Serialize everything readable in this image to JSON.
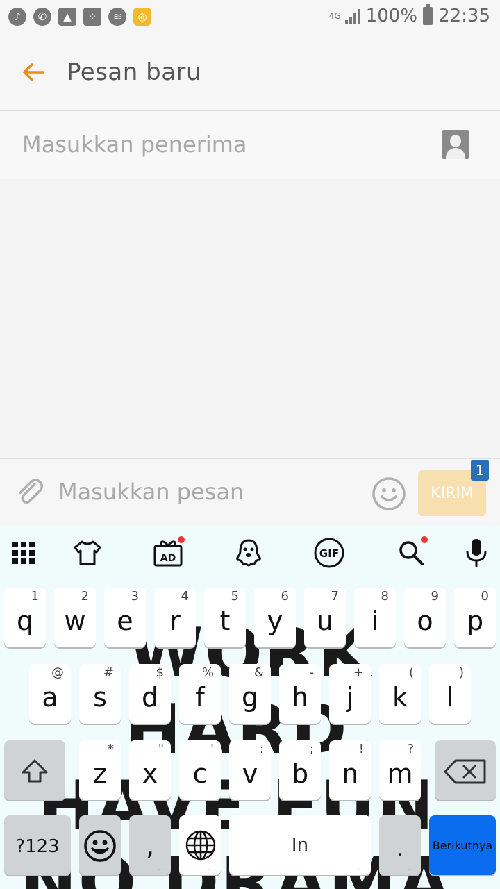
{
  "status_bar": {
    "icons": [
      "music-icon",
      "whatsapp-icon",
      "image-icon",
      "bbm-icon",
      "wifi-icon",
      "app-icon"
    ],
    "network": "4G",
    "battery": "100%",
    "time": "22:35"
  },
  "app_bar": {
    "title": "Pesan baru"
  },
  "recipient": {
    "placeholder": "Masukkan penerima"
  },
  "compose": {
    "placeholder": "Masukkan pesan",
    "send_label": "KIRIM",
    "sim_badge": "1"
  },
  "keyboard": {
    "toolbar": [
      "apps-grid-icon",
      "theme-icon",
      "ad-gift-icon",
      "ghost-icon",
      "gif-icon",
      "search-icon",
      "mic-icon"
    ],
    "gif_label": "GIF",
    "ad_label": "AD",
    "wallpaper_lines": [
      "WORK HARD.",
      "HAVE FUN.",
      "NO DRAMA."
    ],
    "row1": [
      {
        "key": "q",
        "hint": "1"
      },
      {
        "key": "w",
        "hint": "2"
      },
      {
        "key": "e",
        "hint": "3"
      },
      {
        "key": "r",
        "hint": "4"
      },
      {
        "key": "t",
        "hint": "5"
      },
      {
        "key": "y",
        "hint": "6"
      },
      {
        "key": "u",
        "hint": "7"
      },
      {
        "key": "i",
        "hint": "8"
      },
      {
        "key": "o",
        "hint": "9"
      },
      {
        "key": "p",
        "hint": "0"
      }
    ],
    "row2": [
      {
        "key": "a",
        "hint": "@"
      },
      {
        "key": "s",
        "hint": "#"
      },
      {
        "key": "d",
        "hint": "$"
      },
      {
        "key": "f",
        "hint": "%"
      },
      {
        "key": "g",
        "hint": "&"
      },
      {
        "key": "h",
        "hint": "-"
      },
      {
        "key": "j",
        "hint": "+"
      },
      {
        "key": "k",
        "hint": "("
      },
      {
        "key": "l",
        "hint": ")"
      }
    ],
    "row3": [
      {
        "key": "z",
        "hint": "*"
      },
      {
        "key": "x",
        "hint": "\""
      },
      {
        "key": "c",
        "hint": "'"
      },
      {
        "key": "v",
        "hint": ":"
      },
      {
        "key": "b",
        "hint": ";"
      },
      {
        "key": "n",
        "hint": "!"
      },
      {
        "key": "m",
        "hint": "?"
      }
    ],
    "symbols_label": "?123",
    "comma_label": ",",
    "space_label": "In",
    "period_label": ".",
    "enter_label": "Berikutnya",
    "more_dots": "..."
  },
  "colors": {
    "accent": "#ef8a17",
    "send_disabled": "#f8dfb0",
    "enter_key": "#0a6df0",
    "badge": "#2a6fb8"
  }
}
